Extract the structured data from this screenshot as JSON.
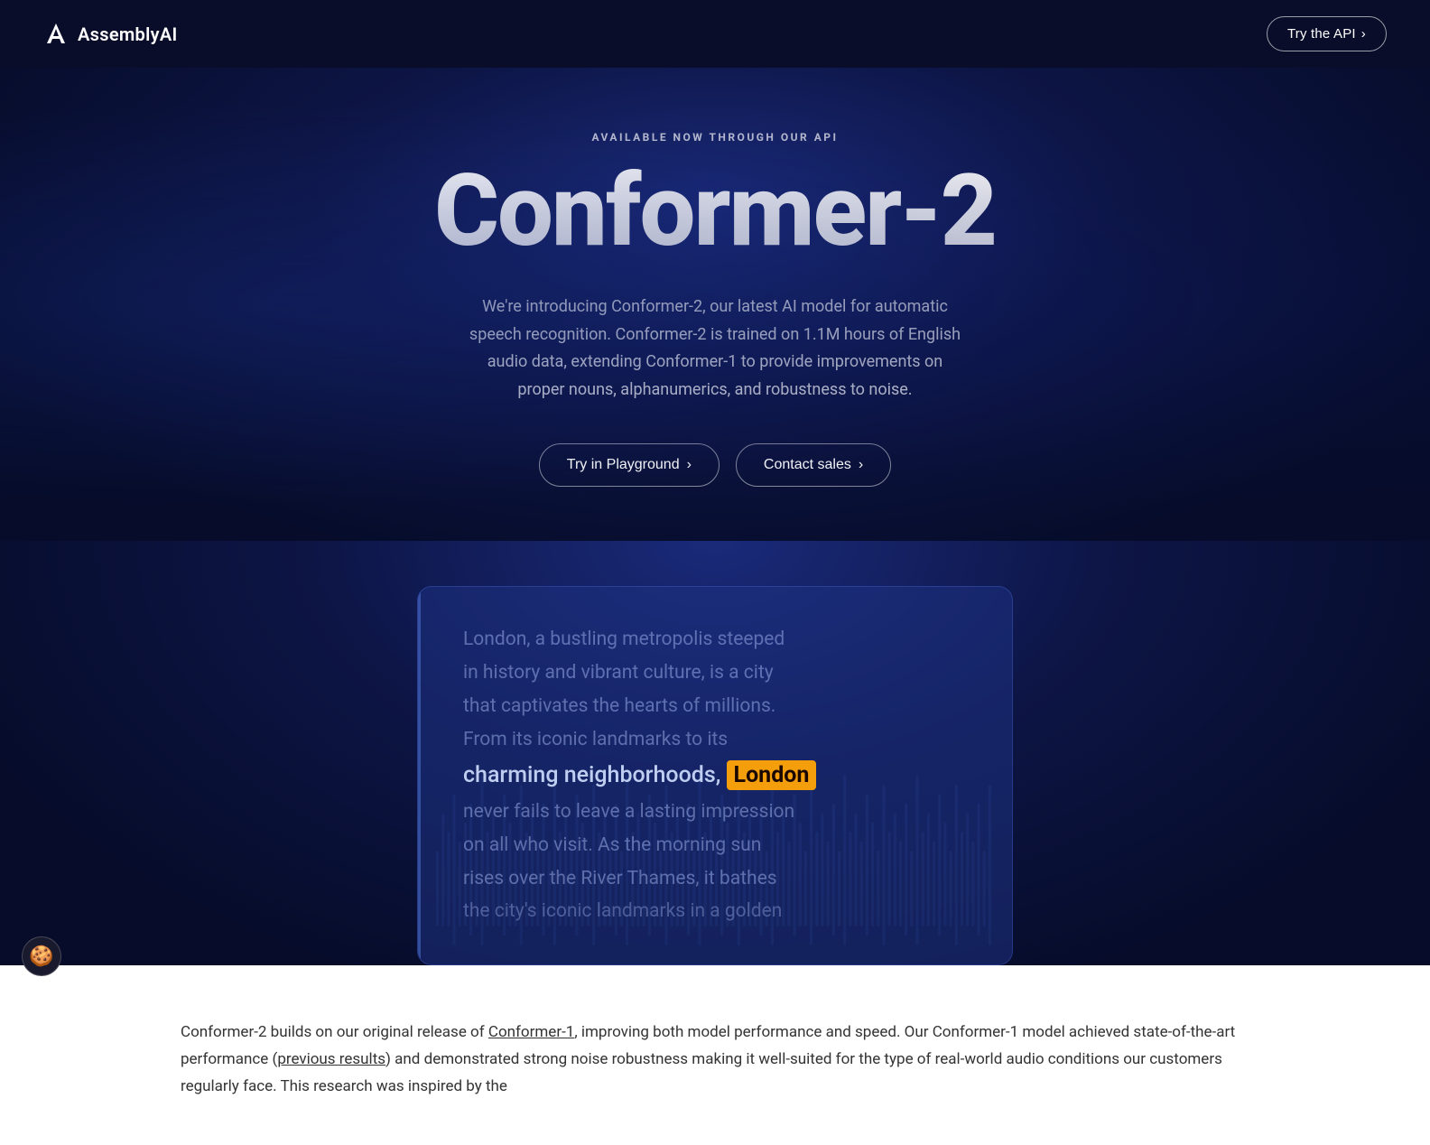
{
  "navbar": {
    "logo_text": "AssemblyAI",
    "try_api_label": "Try the API",
    "try_api_arrow": "›"
  },
  "hero": {
    "available_label": "AVAILABLE NOW THROUGH OUR API",
    "title": "Conformer-2",
    "description": "We're introducing Conformer-2, our latest AI model for automatic speech recognition. Conformer-2 is trained on 1.1M hours of English audio data, extending Conformer-1 to provide improvements on proper nouns, alphanumerics, and robustness to noise.",
    "btn_playground_label": "Try in Playground",
    "btn_playground_arrow": "›",
    "btn_contact_label": "Contact sales",
    "btn_contact_arrow": "›"
  },
  "demo": {
    "text_line1": "London, a bustling metropolis steeped",
    "text_line2": "in history and vibrant culture, is a city",
    "text_line3": "that captivates the hearts of millions.",
    "text_line4": "From its iconic landmarks to its",
    "text_line5_before": "charming neighborhoods, ",
    "text_line5_highlighted": "London",
    "text_line6": "never fails to leave a lasting impression",
    "text_line7": "on all who visit. As the morning sun",
    "text_line8": "rises over the River Thames, it bathes",
    "text_line9": "the city's iconic landmarks in a golden"
  },
  "bottom": {
    "text_intro": "Conformer-2 builds on our original release of ",
    "conformer1_link": "Conformer-1",
    "text_middle": ", improving both model performance and speed. Our Conformer-1 model achieved state-of-the-art performance (",
    "prev_results_link": "previous results",
    "text_end": ") and demonstrated strong noise robustness making it well-suited for the type of real-world audio conditions our customers regularly face. This research was inspired by the"
  },
  "cookie": {
    "icon": "🍪"
  },
  "colors": {
    "accent": "#f59e0b",
    "bg_dark": "#0a0e2a",
    "bg_hero": "#0d1545",
    "text_light": "rgba(255,255,255,0.85)"
  }
}
